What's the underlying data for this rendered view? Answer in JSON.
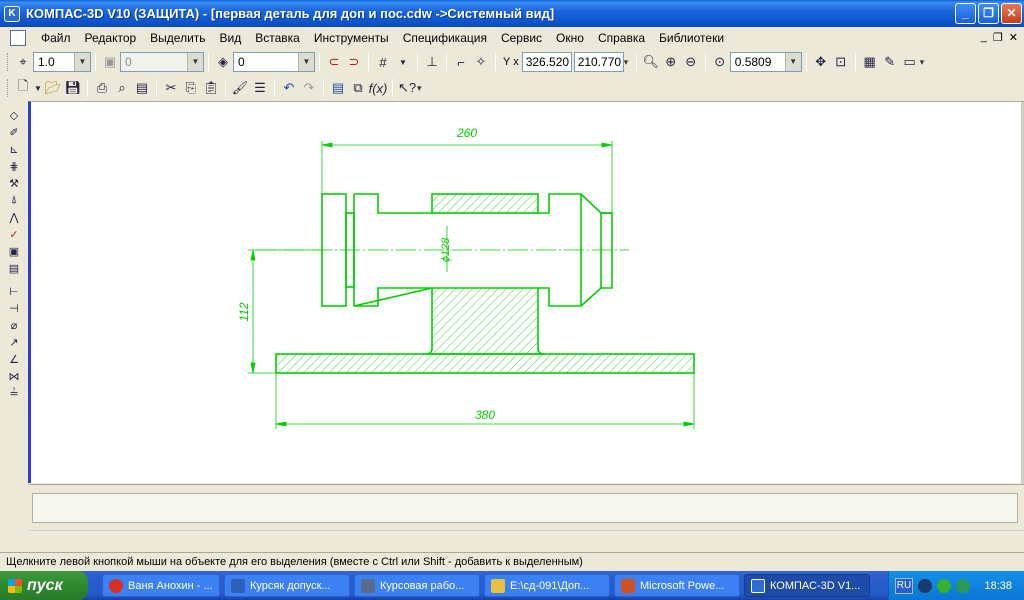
{
  "window": {
    "title": "КОМПАС-3D V10 (ЗАЩИТА) - [первая деталь для доп и пос.cdw ->Системный вид]",
    "app_icon_letter": "K",
    "minimize": "_",
    "maximize": "❐",
    "close": "✕"
  },
  "menu": {
    "items": [
      "Файл",
      "Редактор",
      "Выделить",
      "Вид",
      "Вставка",
      "Инструменты",
      "Спецификация",
      "Сервис",
      "Окно",
      "Справка",
      "Библиотеки"
    ],
    "mdi_minimize": "_",
    "mdi_restore": "❐",
    "mdi_close": "✕"
  },
  "toolbar1": {
    "scale_value": "1.0",
    "layer_value": "0",
    "style_value": "0",
    "coord_label": "Y x",
    "coord_x": "326.520",
    "coord_y": "210.770",
    "zoom_value": "0.5809"
  },
  "drawing": {
    "dim_top": "260",
    "dim_bottom": "380",
    "dim_left": "112",
    "dim_dia": "ϕ128",
    "line_color": "#00d000"
  },
  "status": {
    "hint": "Щелкните левой кнопкой мыши на объекте для его выделения (вместе с Ctrl или Shift - добавить к выделенным)"
  },
  "taskbar": {
    "start_label": "пуск",
    "tasks": [
      {
        "label": "Ваня Анохин - ...",
        "icon_color": "#d83020"
      },
      {
        "label": "Курсяк допуск...",
        "icon_color": "#2b5fb8"
      },
      {
        "label": "Курсовая рабо...",
        "icon_color": "#5a6a8a"
      },
      {
        "label": "E:\\сд-091\\Доп...",
        "icon_color": "#e8c040"
      },
      {
        "label": "Microsoft Powe...",
        "icon_color": "#d05020"
      },
      {
        "label": "КОМПАС-3D V1...",
        "icon_color": "#2a6fd0"
      }
    ],
    "lang": "RU",
    "clock": "18:38"
  }
}
